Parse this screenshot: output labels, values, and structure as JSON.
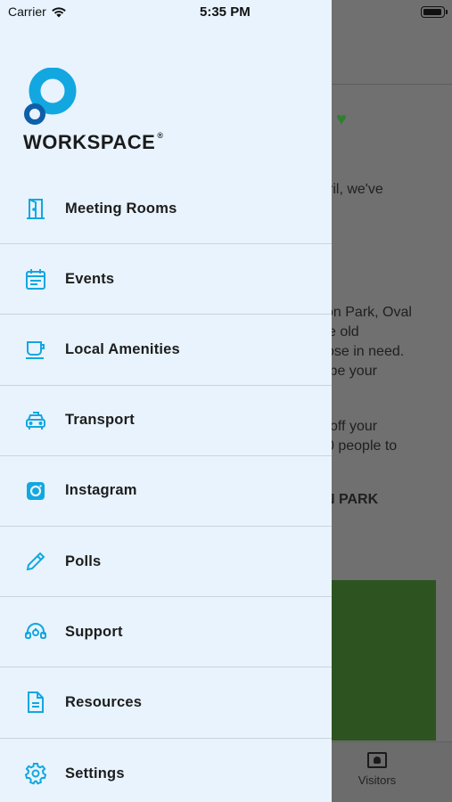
{
  "status_bar": {
    "carrier": "Carrier",
    "time": "5:35 PM"
  },
  "brand": {
    "name": "WORKSPACE",
    "registered": "®"
  },
  "menu": {
    "items": [
      {
        "label": "Meeting Rooms",
        "icon": "door-icon"
      },
      {
        "label": "Events",
        "icon": "calendar-icon"
      },
      {
        "label": "Local Amenities",
        "icon": "coffee-cup-icon"
      },
      {
        "label": "Transport",
        "icon": "taxi-icon"
      },
      {
        "label": "Instagram",
        "icon": "instagram-icon"
      },
      {
        "label": "Polls",
        "icon": "pencil-icon"
      },
      {
        "label": "Support",
        "icon": "support-headset-icon"
      },
      {
        "label": "Resources",
        "icon": "document-icon"
      },
      {
        "label": "Settings",
        "icon": "gear-icon"
      }
    ]
  },
  "background": {
    "line1": "ril, we've",
    "line2": "on Park, Oval",
    "line3": "e old",
    "line4": "ose in need.",
    "line5": "ipe your",
    "line6": "off your",
    "line7": "0 people to",
    "heading": "N PARK",
    "tab_label": "Visitors"
  },
  "colors": {
    "accent": "#12a7e0",
    "drawer_bg": "#e8f3fd"
  }
}
